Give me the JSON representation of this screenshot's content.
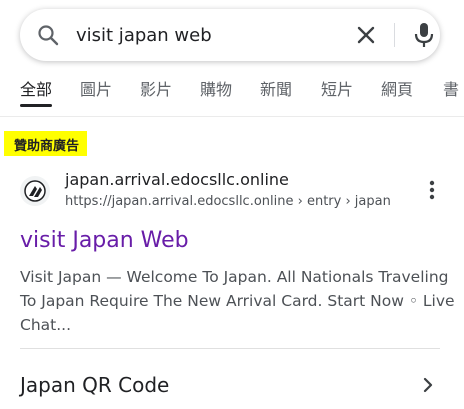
{
  "search": {
    "query": "visit japan web"
  },
  "tabs": [
    {
      "label": "全部",
      "active": true
    },
    {
      "label": "圖片"
    },
    {
      "label": "影片"
    },
    {
      "label": "購物"
    },
    {
      "label": "新聞"
    },
    {
      "label": "短片"
    },
    {
      "label": "網頁"
    },
    {
      "label": "書"
    }
  ],
  "ad": {
    "sponsored_label": "贊助商廣告",
    "site_name": "japan.arrival.edocsllc.online",
    "url": "https://japan.arrival.edocsllc.online › entry › japan",
    "title": "visit Japan Web",
    "snippet_lines": [
      "Visit Japan — Welcome To Japan. All Nationals Traveling",
      "To Japan Require The New Arrival Card. Start Now ◦ Live",
      "Chat..."
    ],
    "sitelink": "Japan QR Code"
  },
  "colors": {
    "title_link": "#681da8",
    "highlight": "#ffff00",
    "mic_blue": "#1a73e8"
  },
  "icons": [
    "search-icon",
    "close-icon",
    "mic-icon",
    "more-vert-icon",
    "chevron-right-icon"
  ]
}
